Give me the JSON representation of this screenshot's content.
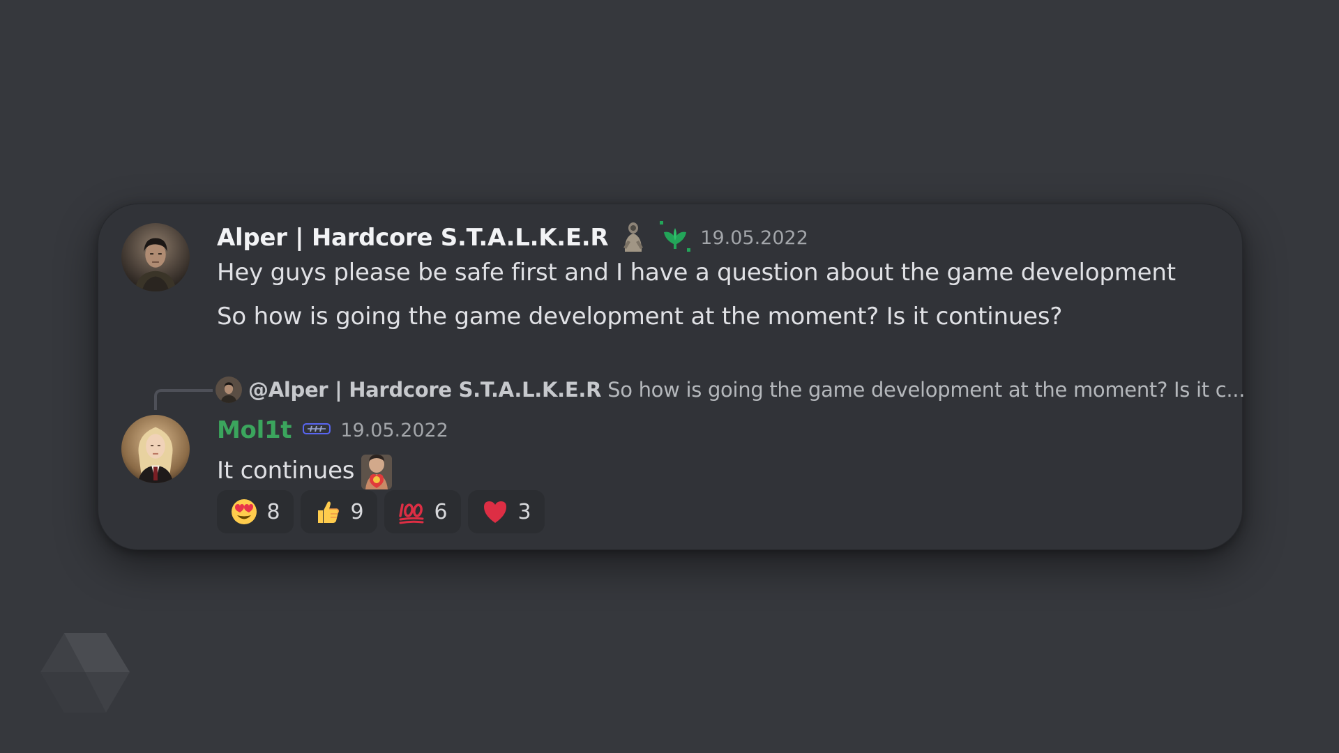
{
  "messages": [
    {
      "username": "Alper | Hardcore S.T.A.L.K.E.R",
      "timestamp": "19.05.2022",
      "lines": [
        "Hey guys please be safe first and I have a question about the game development",
        "So how is going the game development at the moment? Is it continues?"
      ],
      "badges": [
        "stalker-figure-icon",
        "hypesquad-growth-icon"
      ]
    },
    {
      "reply": {
        "mention": "@Alper | Hardcore S.T.A.L.K.E.R",
        "text": "So how is going the game development at the moment? Is it c..."
      },
      "username": "Mol1t",
      "username_color": "#3ba55d",
      "timestamp": "19.05.2022",
      "text": "It continues",
      "badges": [
        "nitro-badge-icon"
      ],
      "reactions": [
        {
          "emoji": "heart-eyes-icon",
          "count": "8"
        },
        {
          "emoji": "thumbs-up-icon",
          "count": "9"
        },
        {
          "emoji": "hundred-points-icon",
          "count": "6"
        },
        {
          "emoji": "red-heart-icon",
          "count": "3"
        }
      ]
    }
  ],
  "colors": {
    "background": "#36383d",
    "card": "#313338",
    "reaction_bg": "#2b2d31",
    "timestamp": "#a3a6aa",
    "green_name": "#3ba55d"
  }
}
